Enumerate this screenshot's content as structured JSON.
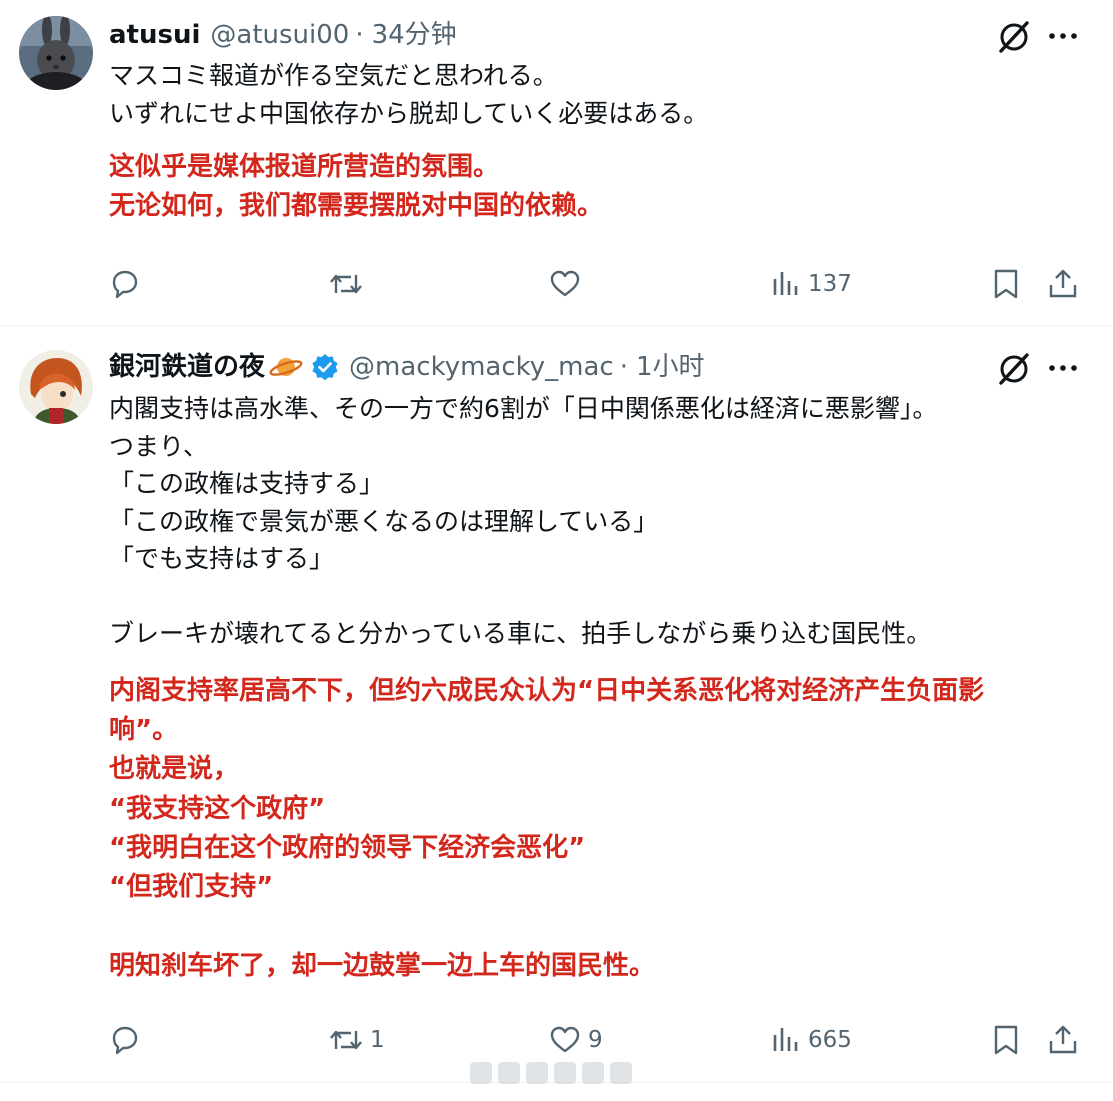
{
  "posts": [
    {
      "author": {
        "display_name": "atusui",
        "handle": "@atusui00",
        "verified": false
      },
      "time": "34分钟",
      "avatar_icon": "rabbit-avatar",
      "text_jp": [
        "マスコミ報道が作る空気だと思われる。",
        "いずれにせよ中国依存から脱却していく必要はある。"
      ],
      "text_zh": [
        "这似乎是媒体报道所营造的氛围。",
        "无论如何，我们都需要摆脱对中国的依赖。"
      ],
      "actions": {
        "reply_count": "",
        "repost_count": "",
        "like_count": "",
        "views_count": "137"
      }
    },
    {
      "author": {
        "display_name": "銀河鉄道の夜",
        "handle": "@mackymacky_mac",
        "verified": true
      },
      "time": "1小时",
      "avatar_icon": "anime-character-avatar",
      "text_jp": [
        "内閣支持は高水準、その一方で約6割が「日中関係悪化は経済に悪影響」。",
        "つまり、",
        "「この政権は支持する」",
        "「この政権で景気が悪くなるのは理解している」",
        "「でも支持はする」",
        "",
        "ブレーキが壊れてると分かっている車に、拍手しながら乗り込む国民性。"
      ],
      "text_zh": [
        "内阁支持率居高不下，但约六成民众认为“日中关系恶化将对经济产生负面影",
        "响”。",
        "也就是说，",
        "“我支持这个政府”",
        "“我明白在这个政府的领导下经济会恶化”",
        "“但我们支持”",
        "",
        "明知刹车坏了，却一边鼓掌一边上车的国民性。"
      ],
      "actions": {
        "reply_count": "",
        "repost_count": "1",
        "like_count": "9",
        "views_count": "665"
      }
    }
  ],
  "colors": {
    "text_primary": "#0f1419",
    "text_secondary": "#536471",
    "translation_red": "#d3271c",
    "verified_blue": "#1d9bf0",
    "divider": "#eff3f4"
  },
  "icons": [
    "grok-icon",
    "more-icon",
    "reply-icon",
    "repost-icon",
    "like-icon",
    "views-icon",
    "bookmark-icon",
    "share-icon",
    "verified-icon",
    "planet-icon"
  ]
}
